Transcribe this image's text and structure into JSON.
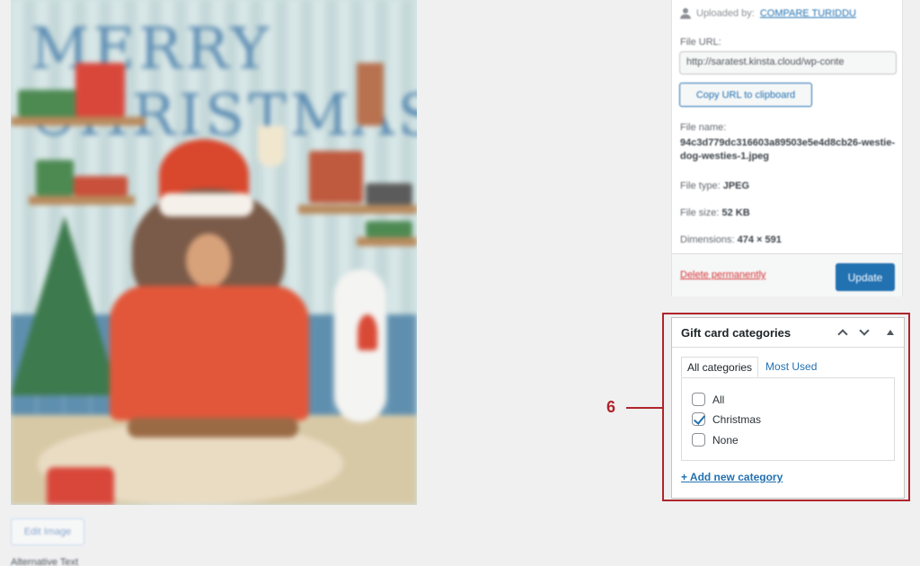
{
  "preview": {
    "title_text": "MERRY CHRISTMAS",
    "edit_image_label": "Edit Image",
    "alt_text_label": "Alternative Text"
  },
  "details": {
    "uploaded_by_label": "Uploaded by:",
    "uploader": "COMPARE TURIDDU",
    "file_url_label": "File URL:",
    "file_url_value": "http://saratest.kinsta.cloud/wp-conte",
    "copy_url_label": "Copy URL to clipboard",
    "file_name_label": "File name:",
    "file_name_value": "94c3d779dc316603a89503e5e4d8cb26-westie-dog-westies-1.jpeg",
    "file_type_label": "File type:",
    "file_type_value": "JPEG",
    "file_size_label": "File size:",
    "file_size_value": "52 KB",
    "dimensions_label": "Dimensions:",
    "dimensions_value": "474 × 591",
    "delete_label": "Delete permanently",
    "update_label": "Update"
  },
  "gift_card_categories": {
    "title": "Gift card categories",
    "tabs": [
      {
        "label": "All categories",
        "active": true
      },
      {
        "label": "Most Used",
        "active": false
      }
    ],
    "items": [
      {
        "label": "All",
        "checked": false
      },
      {
        "label": "Christmas",
        "checked": true
      },
      {
        "label": "None",
        "checked": false
      }
    ],
    "add_new_label": "+ Add new category"
  },
  "callout": {
    "number": "6",
    "color": "#b0252b"
  },
  "colors": {
    "accent": "#2271b1",
    "danger": "#d63638"
  }
}
